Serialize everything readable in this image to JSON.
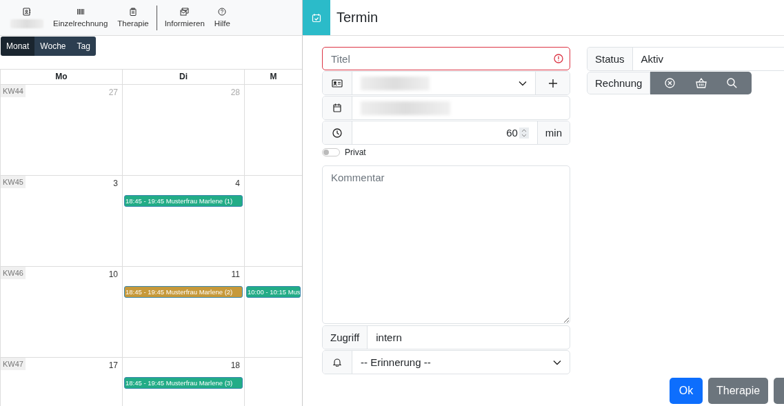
{
  "toolbar": {
    "items": [
      {
        "kind": "contact",
        "redacted": true
      },
      {
        "kind": "barcode",
        "label": "Einzelrechnung"
      },
      {
        "kind": "clipboard",
        "label": "Therapie",
        "divider_after": true
      },
      {
        "kind": "mail",
        "label": "Informieren"
      },
      {
        "kind": "help",
        "label": "Hilfe"
      }
    ]
  },
  "view_buttons": [
    {
      "label": "Monat",
      "selected": true
    },
    {
      "label": "Woche",
      "selected": false
    },
    {
      "label": "Tag",
      "selected": false
    }
  ],
  "calendar": {
    "columns": [
      "Mo",
      "Di",
      "M"
    ],
    "weeks": [
      {
        "week": "KW44",
        "days": [
          {
            "date": "27",
            "muted": true
          },
          {
            "date": "28",
            "muted": true
          }
        ]
      },
      {
        "week": "KW45",
        "days": [
          {
            "date": "3",
            "muted": false
          },
          {
            "date": "4",
            "muted": false,
            "events": [
              {
                "text": "18:45 - 19:45 Musterfrau Marlene (1)",
                "color": "#22ac87"
              }
            ]
          }
        ]
      },
      {
        "week": "KW46",
        "days": [
          {
            "date": "10",
            "muted": false
          },
          {
            "date": "11",
            "muted": false,
            "events": [
              {
                "text": "18:45 - 19:45 Musterfrau Marlene (2)",
                "color": "#c6993a"
              }
            ]
          },
          {
            "events": [
              {
                "text": "10:00 - 10:15 Mus",
                "color": "#22ac87"
              }
            ]
          }
        ]
      },
      {
        "week": "KW47",
        "days": [
          {
            "date": "17",
            "muted": false
          },
          {
            "date": "18",
            "muted": false,
            "events": [
              {
                "text": "18:45 - 19:45 Musterfrau Marlene (3)",
                "color": "#22ac87"
              }
            ]
          }
        ]
      }
    ]
  },
  "dialog": {
    "title": "Termin",
    "form": {
      "title_field": {
        "placeholder": "Titel",
        "invalid": true
      },
      "patient": {
        "redacted": true
      },
      "date": {
        "redacted": true
      },
      "duration": {
        "value": "60",
        "unit": "min"
      },
      "private": {
        "label": "Privat",
        "on": false
      },
      "comment": {
        "placeholder": "Kommentar"
      },
      "access": {
        "label": "Zugriff",
        "value": "intern"
      },
      "reminder": {
        "value": "-- Erinnerung --"
      }
    },
    "status": {
      "label": "Status",
      "value": "Aktiv"
    },
    "invoice": {
      "label": "Rechnung"
    },
    "buttons": [
      {
        "label": "Ok",
        "kind": "primary"
      },
      {
        "label": "Therapie",
        "kind": "secondary"
      },
      {
        "kind": "secondary"
      }
    ]
  }
}
